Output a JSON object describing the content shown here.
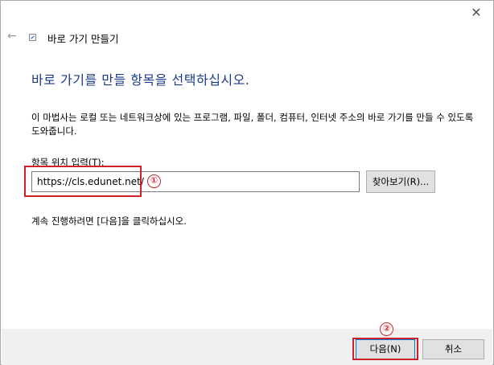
{
  "window": {
    "title": "바로 가기 만들기",
    "close_glyph": "✕",
    "back_glyph": "←"
  },
  "heading": "바로 가기를 만들 항목을 선택하십시오.",
  "intro": "이 마법사는 로컬 또는 네트워크상에 있는 프로그램, 파일, 폴더, 컴퓨터, 인터넷 주소의 바로 가기를 만들 수 있도록 도와줍니다.",
  "location": {
    "label": "항목 위치 입력(T):",
    "value": "https://cls.edunet.net/",
    "browse_label": "찾아보기(R)..."
  },
  "instruction": "계속 진행하려면 [다음]을 클릭하십시오.",
  "footer": {
    "next_label": "다음(N)",
    "cancel_label": "취소"
  },
  "annotations": {
    "step1": "①",
    "step2": "②",
    "color": "#d0212b"
  },
  "colors": {
    "heading": "#1a3a8c",
    "footer_bg": "#f0f0f0",
    "button_bg": "#e1e1e1",
    "focus_border": "#0078d7"
  }
}
